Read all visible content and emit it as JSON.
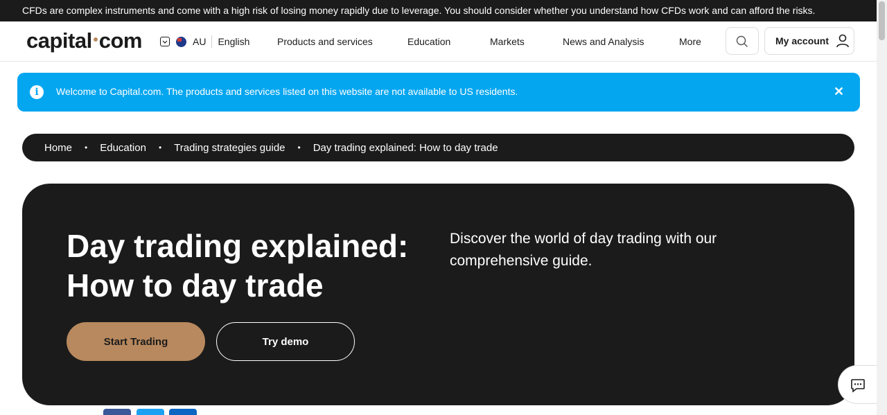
{
  "risk_warning": "CFDs are complex instruments and come with a high risk of losing money rapidly due to leverage. You should consider whether you understand how CFDs work and can afford the risks.",
  "header": {
    "logo_left": "capital",
    "logo_right": "com",
    "region": "AU",
    "language": "English",
    "nav": [
      "Products and services",
      "Education",
      "Markets",
      "News and Analysis",
      "More"
    ],
    "account_label": "My account"
  },
  "banner": {
    "message": "Welcome to Capital.com. The products and services listed on this website are not available to US residents.",
    "close_symbol": "✕",
    "info_symbol": "i"
  },
  "breadcrumb": {
    "items": [
      "Home",
      "Education",
      "Trading strategies guide"
    ],
    "current": "Day trading explained: How to day trade",
    "separator": "•"
  },
  "hero": {
    "title": "Day trading explained: How to day trade",
    "description": "Discover the world of day trading with our comprehensive guide.",
    "primary_button": "Start Trading",
    "secondary_button": "Try demo"
  },
  "colors": {
    "dark": "#1b1b1b",
    "accent": "#b8895e",
    "banner": "#05a6f0",
    "facebook": "#3b5998",
    "twitter": "#1da1f2",
    "linkedin": "#0a66c2"
  },
  "icons": {
    "search": "search-icon",
    "account": "user-icon",
    "chat": "chat-icon"
  }
}
